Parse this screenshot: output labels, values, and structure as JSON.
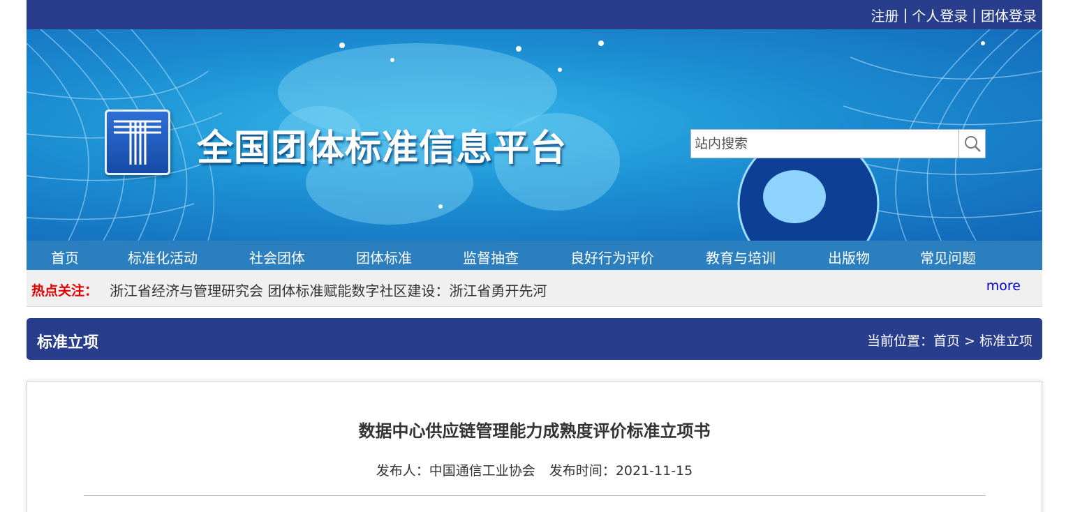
{
  "topbar": {
    "register": "注册",
    "personal_login": "个人登录",
    "group_login": "团体登录",
    "separator": "|"
  },
  "header": {
    "site_title": "全国团体标准信息平台",
    "logo_icon": "platform-logo-icon",
    "search": {
      "placeholder": "站内搜索",
      "value": "",
      "icon": "search-icon"
    }
  },
  "nav": {
    "items": [
      {
        "label": "首页"
      },
      {
        "label": "标准化活动"
      },
      {
        "label": "社会团体"
      },
      {
        "label": "团体标准"
      },
      {
        "label": "监督抽查"
      },
      {
        "label": "良好行为评价"
      },
      {
        "label": "教育与培训"
      },
      {
        "label": "出版物"
      },
      {
        "label": "常见问题"
      }
    ]
  },
  "hot": {
    "label": "热点关注：",
    "text": "浙江省经济与管理研究会 团体标准赋能数字社区建设：浙江省勇开先河",
    "more": "more"
  },
  "section": {
    "title": "标准立项",
    "location_label": "当前位置：",
    "crumb_home": "首页",
    "crumb_sep": ">",
    "crumb_current": "标准立项"
  },
  "article": {
    "title": "数据中心供应链管理能力成熟度评价标准立项书",
    "publisher_label": "发布人：",
    "publisher": "中国通信工业协会",
    "date_label": "发布时间：",
    "date": "2021-11-15"
  },
  "colors": {
    "primary_dark_blue": "#283e8c",
    "nav_blue": "#2b7fbf",
    "hot_red": "#e60000",
    "more_link": "#0000cc"
  }
}
